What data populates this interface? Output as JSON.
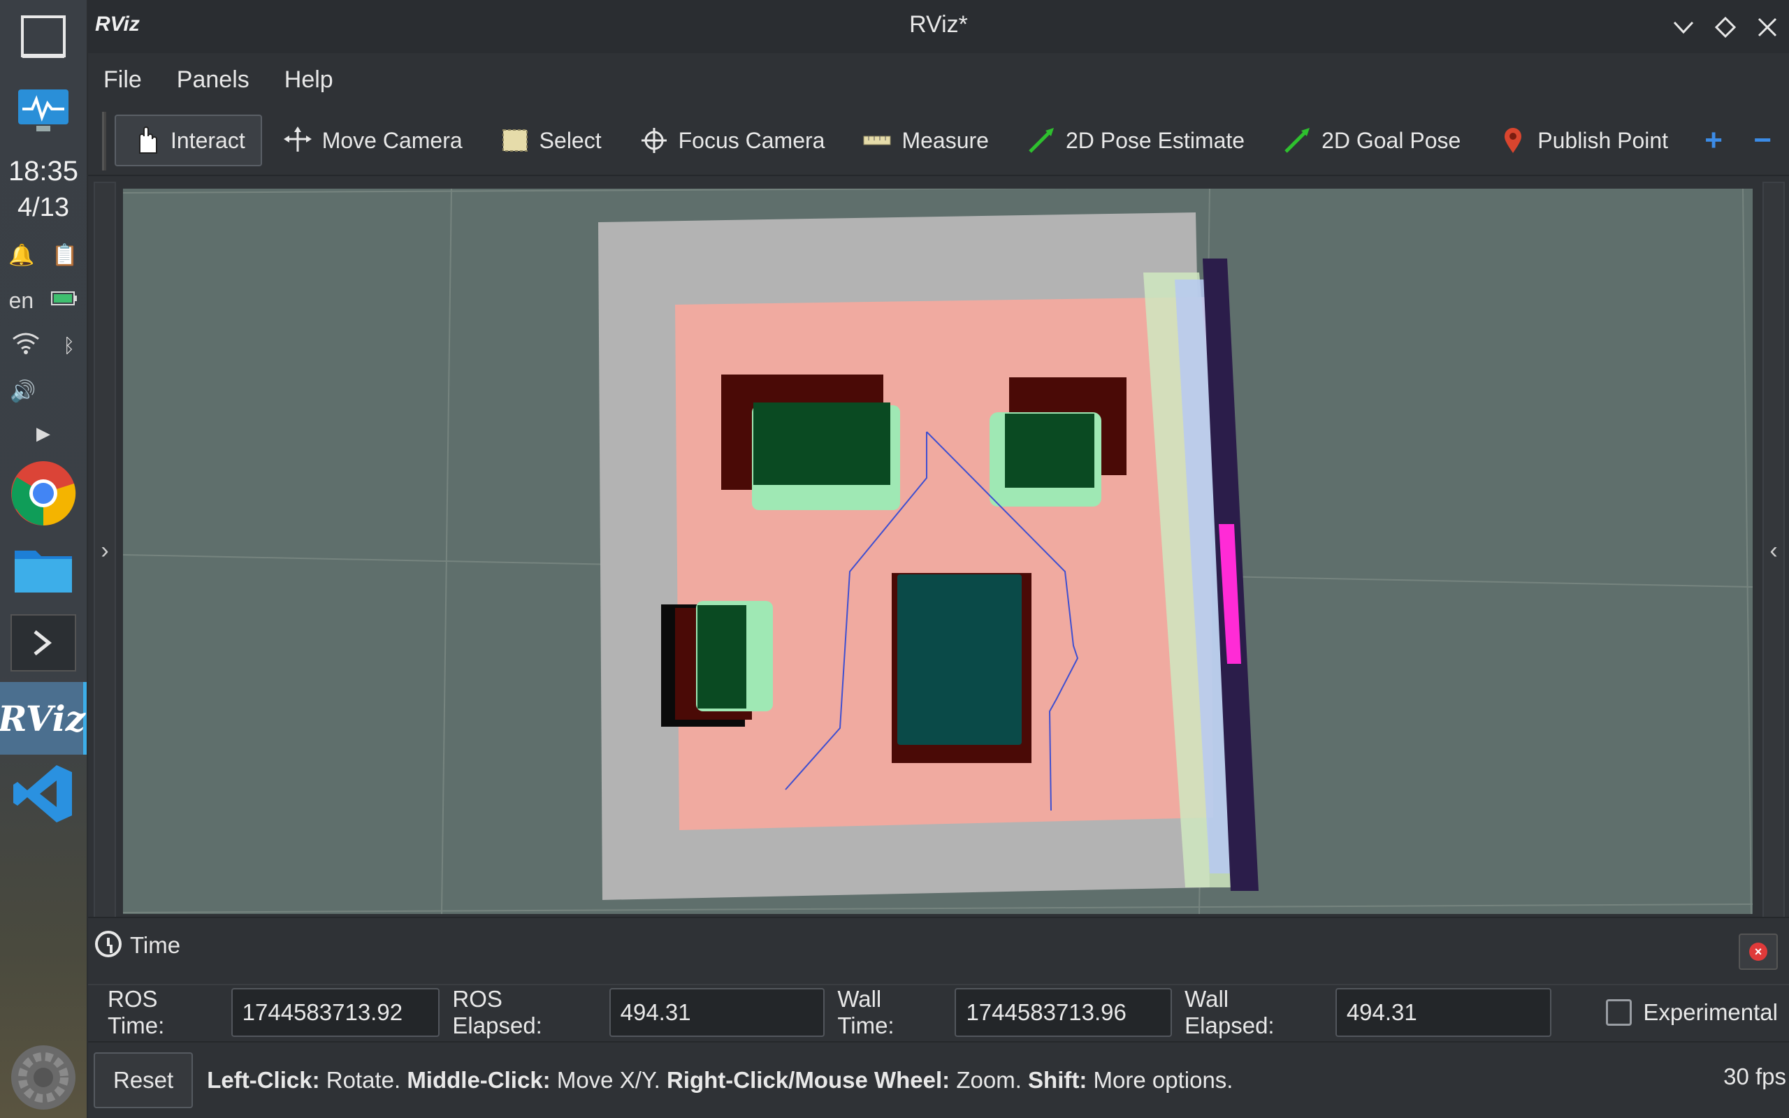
{
  "dock": {
    "clock_time": "18:35",
    "clock_date": "4/13",
    "language": "en",
    "apps": [
      "chrome-icon",
      "files-icon",
      "terminal-icon",
      "rviz-icon",
      "vscode-icon"
    ]
  },
  "window": {
    "logo": "RViz",
    "title": "RViz*"
  },
  "menu": {
    "file": "File",
    "panels": "Panels",
    "help": "Help"
  },
  "toolbar": {
    "interact": "Interact",
    "move_camera": "Move Camera",
    "select": "Select",
    "focus_camera": "Focus Camera",
    "measure": "Measure",
    "pose_estimate": "2D Pose Estimate",
    "goal_pose": "2D Goal Pose",
    "publish_point": "Publish Point",
    "add": "+",
    "remove": "−"
  },
  "time_panel": {
    "title": "Time",
    "ros_time_label": "ROS Time:",
    "ros_time": "1744583713.92",
    "ros_elapsed_label": "ROS Elapsed:",
    "ros_elapsed": "494.31",
    "wall_time_label": "Wall Time:",
    "wall_time": "1744583713.96",
    "wall_elapsed_label": "Wall Elapsed:",
    "wall_elapsed": "494.31",
    "experimental_label": "Experimental"
  },
  "status": {
    "reset": "Reset",
    "hint_left_click": "Left-Click:",
    "hint_rotate": "Rotate.",
    "hint_middle_click": "Middle-Click:",
    "hint_move": "Move X/Y.",
    "hint_right_click": "Right-Click/Mouse Wheel:",
    "hint_zoom": "Zoom.",
    "hint_shift": "Shift:",
    "hint_more": "More options.",
    "fps": "30 fps"
  },
  "colors": {
    "accent": "#3daee9",
    "viewport_bg": "#5f6f6c",
    "costmap": "#f2aaa0",
    "map_free": "#b3b3b3"
  }
}
